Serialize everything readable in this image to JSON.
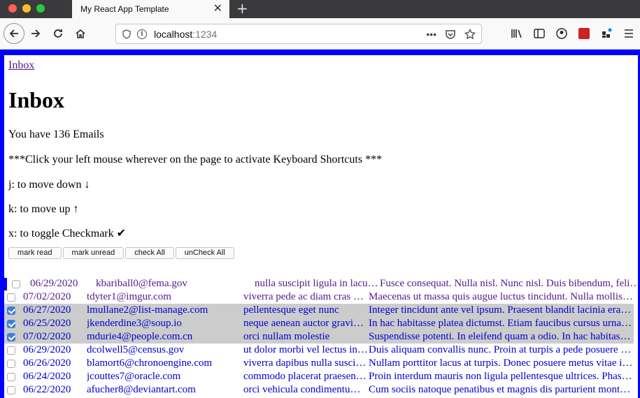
{
  "browser": {
    "tab_title": "My React App Template",
    "tab_close": "✕",
    "new_tab": "+",
    "url_host": "localhost",
    "url_port": ":1234",
    "url_menu": "•••"
  },
  "page": {
    "breadcrumb": "Inbox",
    "title": "Inbox",
    "email_count_text": "You have 136 Emails",
    "instruction": "***Click your left mouse wherever on the page to activate Keyboard Shortcuts ***",
    "shortcuts": [
      "j: to move down ↓",
      "k: to move up ↑",
      "x: to toggle Checkmark ✔"
    ],
    "buttons": {
      "mark_read": "mark read",
      "mark_unread": "mark unread",
      "check_all": "check All",
      "uncheck_all": "unCheck All"
    }
  },
  "emails": [
    {
      "date": "06/29/2020",
      "from": "kbariball0@fema.gov",
      "subject": "nulla suscipit ligula in lacus. Curabitur",
      "body": "Fusce consequat. Nulla nisl. Nunc nisl. Duis bibendum, felis sed interdum",
      "checked": false,
      "read": true,
      "active": true
    },
    {
      "date": "07/02/2020",
      "from": "tdyter1@imgur.com",
      "subject": "viverra pede ac diam cras pellentesque",
      "body": "Maecenas ut massa quis augue luctus tincidunt. Nulla mollis molestie lorem",
      "checked": false,
      "read": true,
      "active": false
    },
    {
      "date": "06/27/2020",
      "from": "lmullane2@list-manage.com",
      "subject": "pellentesque eget nunc",
      "body": "Integer tincidunt ante vel ipsum. Praesent blandit lacinia erat. Vestibulum",
      "checked": true,
      "read": false,
      "active": false
    },
    {
      "date": "06/25/2020",
      "from": "jkenderdine3@soup.io",
      "subject": "neque aenean auctor gravida sem",
      "body": "In hac habitasse platea dictumst. Etiam faucibus cursus urna. Ut tellus",
      "checked": true,
      "read": false,
      "active": false
    },
    {
      "date": "07/02/2020",
      "from": "mdurie4@people.com.cn",
      "subject": "orci nullam molestie",
      "body": "Suspendisse potenti. In eleifend quam a odio. In hac habitasse platea",
      "checked": true,
      "read": false,
      "active": false
    },
    {
      "date": "06/29/2020",
      "from": "dcolwell5@census.gov",
      "subject": "ut dolor morbi vel lectus in quam",
      "body": "Duis aliquam convallis nunc. Proin at turpis a pede posuere nonummy",
      "checked": false,
      "read": false,
      "active": false
    },
    {
      "date": "06/26/2020",
      "from": "blamort6@chronoengine.com",
      "subject": "viverra dapibus nulla suscipit ligula",
      "body": "Nullam porttitor lacus at turpis. Donec posuere metus vitae ipsum",
      "checked": false,
      "read": false,
      "active": false
    },
    {
      "date": "06/24/2020",
      "from": "jcouttes7@oracle.com",
      "subject": "commodo placerat praesent blandit nam",
      "body": "Proin interdum mauris non ligula pellentesque ultrices. Phasellus id sapien",
      "checked": false,
      "read": false,
      "active": false
    },
    {
      "date": "06/22/2020",
      "from": "afucher8@deviantart.com",
      "subject": "orci vehicula condimentum curabitur in",
      "body": "Cum sociis natoque penatibus et magnis dis parturient montes, nascetur",
      "checked": false,
      "read": false,
      "active": false
    }
  ]
}
